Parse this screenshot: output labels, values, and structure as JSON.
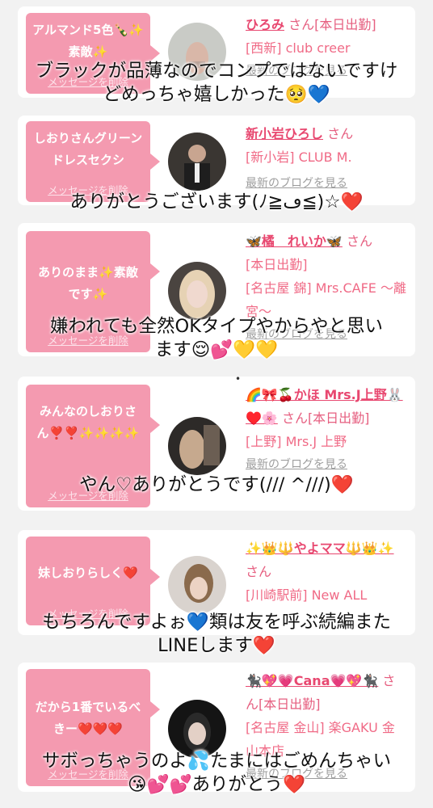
{
  "delete_label": "メッセージを削除",
  "blog_label": "最新のブログを見る",
  "san_label": "さん",
  "cards": [
    {
      "bubble": "アルマンド5色🍾✨素敵✨",
      "name": "ひろみ",
      "san": "さん[本日出勤]",
      "shop": "[西新] club creer",
      "caption": [
        "ブラックが品薄なのでコンプではないですけ",
        "どめっちゃ嬉しかった🥺💙"
      ]
    },
    {
      "bubble": "しおりさんグリーンドレスセクシ",
      "name": "新小岩ひろし",
      "san": "さん",
      "shop": "[新小岩] CLUB M.",
      "caption": [
        "ありがとうございます(ﾉ≧ڡ≦)☆❤️"
      ]
    },
    {
      "bubble": "ありのまま✨素敵です✨",
      "name": "🦋橘　れいか🦋",
      "san": "さん",
      "status": "[本日出勤]",
      "shop": "[名古屋 錦] Mrs.CAFE ～離宮～",
      "caption": [
        "嫌われても全然OKタイプやからやと思い",
        "ます😌💕💛💛"
      ]
    },
    {
      "bubble": "みんなのしおりさん❣️❣️✨✨✨✨",
      "name": "🌈🎀🍒かほ Mrs.J上野🐰♥️🌸",
      "san": "さん[本日出勤]",
      "shop": "[上野] Mrs.J 上野",
      "caption": [
        "やん♡ありがとうです(/// ^///)❤️"
      ]
    },
    {
      "bubble": "妹しおりらしく❤️",
      "name": "✨👑🔱やよママ🔱👑✨",
      "san": "さん",
      "shop": "[川崎駅前] New ALL",
      "caption": [
        "もちろんですよぉ💙類は友を呼ぶ続編また",
        "LINEします❤️"
      ]
    },
    {
      "bubble": "だから1番でいるべきー❤️❤️❤️",
      "name": "🐈‍⬛💖💗Cana💗💖🐈‍⬛",
      "san": "さん[本日出勤]",
      "shop": "[名古屋 金山] 楽GAKU 金山本店",
      "caption": [
        "サボっちゃうのよ💦たまにはごめんちゃい",
        "😘💕💕ありがとう❤️"
      ]
    }
  ]
}
